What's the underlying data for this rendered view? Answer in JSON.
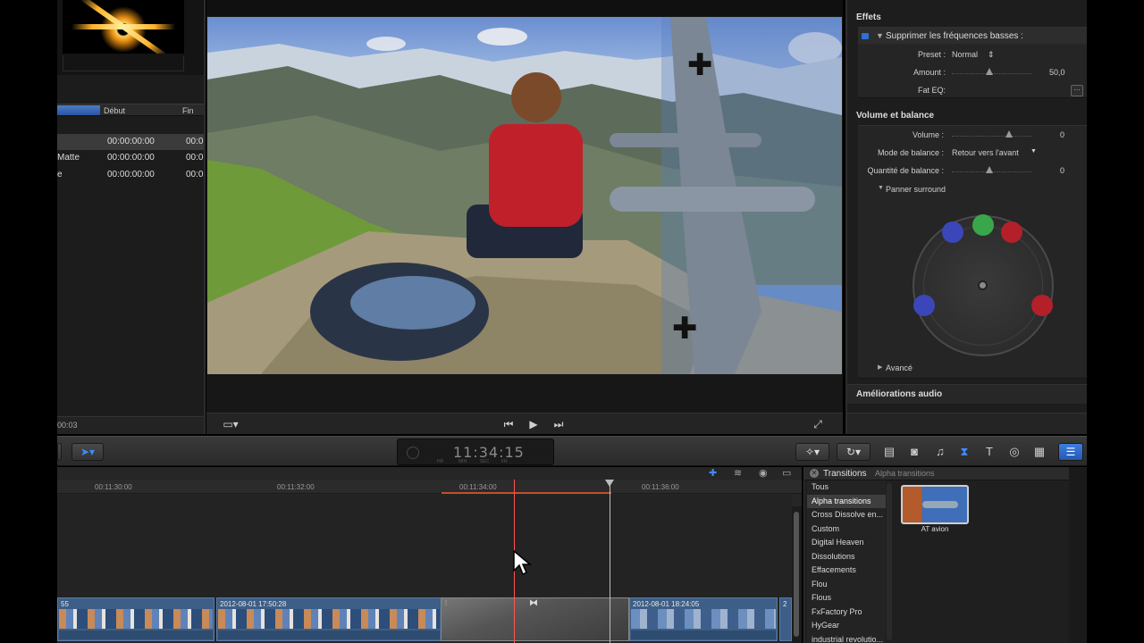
{
  "browser": {
    "columns": {
      "debut": "Début",
      "fin": "Fin"
    },
    "rows": [
      {
        "name": "",
        "debut": "00:00:00:00",
        "fin": "00:0"
      },
      {
        "name": "Matte",
        "debut": "00:00:00:00",
        "fin": "00:0"
      },
      {
        "name": "e",
        "debut": "00:00:00:00",
        "fin": "00:0"
      }
    ],
    "footer_time": "00:03"
  },
  "viewer": {
    "rewind_icon": "skip-back-icon",
    "play_icon": "play-icon",
    "forward_icon": "skip-forward-icon"
  },
  "inspector": {
    "effects": {
      "title": "Effets",
      "filter_name": "Supprimer les fréquences basses :",
      "preset_label": "Preset :",
      "preset_value": "Normal",
      "amount_label": "Amount :",
      "amount_value": "50,0",
      "fat_eq_label": "Fat EQ:"
    },
    "volume": {
      "title": "Volume et balance",
      "volume_label": "Volume :",
      "volume_value": "0",
      "balance_mode_label": "Mode de balance :",
      "balance_mode_value": "Retour vers l'avant",
      "balance_amount_label": "Quantité de balance :",
      "balance_amount_value": "0",
      "panner_label": "Panner surround",
      "advanced_label": "Avancé"
    },
    "audio_enhancements": "Améliorations audio"
  },
  "toolbar": {
    "timecode": "11:34:15",
    "timecode_units": [
      "HR",
      "MIN",
      "SEC",
      "FR"
    ]
  },
  "timeline": {
    "ruler": [
      "00:11:30:00",
      "00:11:32:00",
      "00:11:34:00",
      "00:11:36:00"
    ],
    "clips": [
      {
        "title": "55"
      },
      {
        "title": "2012-08-01 17:50:28"
      },
      {
        "title": "2012-08-01 18:24:05"
      },
      {
        "title": "2"
      }
    ]
  },
  "transitions": {
    "title": "Transitions",
    "selected_category": "Alpha transitions",
    "categories": [
      "Tous",
      "Alpha transitions",
      "Cross Dissolve en...",
      "Custom",
      "Digital Heaven",
      "Dissolutions",
      "Effacements",
      "Flou",
      "Flous",
      "FxFactory Pro",
      "HyGear",
      "industrial revolutio..."
    ],
    "thumbnail_label": "AT avion"
  },
  "colors": {
    "accent_blue": "#2f6fd6",
    "playhead_red": "#ff5555",
    "speaker_green": "#3aa64a",
    "speaker_red": "#b3202a",
    "speaker_blue": "#3b47b8"
  }
}
